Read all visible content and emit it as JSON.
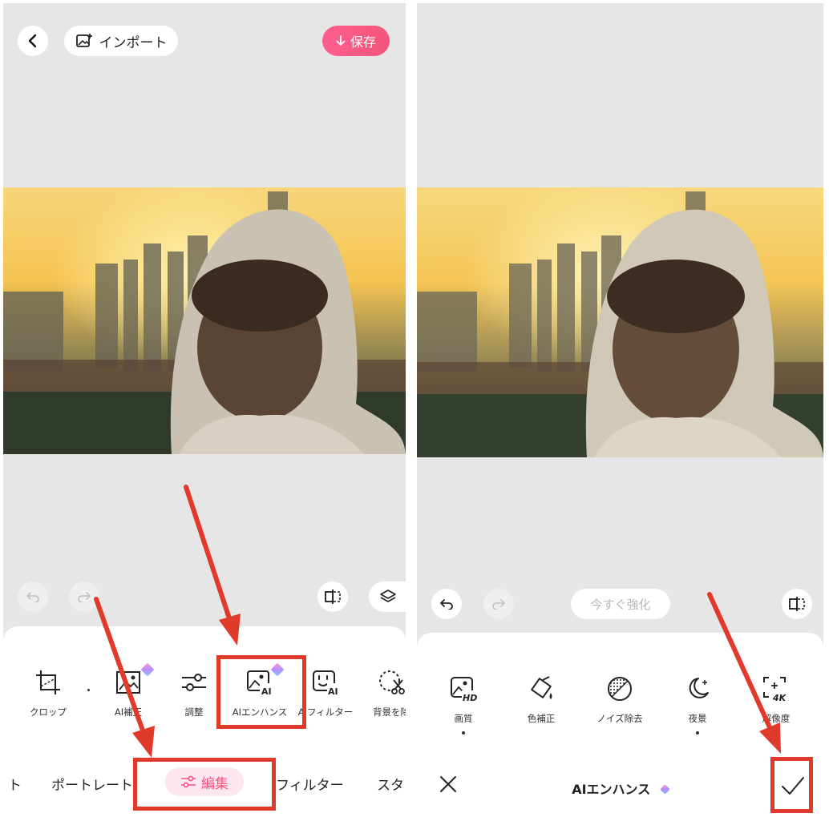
{
  "left": {
    "header": {
      "import_label": "インポート",
      "save_label": "保存"
    },
    "tools": [
      {
        "label": "クロップ",
        "icon": "crop-icon"
      },
      {
        "label": "AI補正",
        "icon": "ai-correct-icon"
      },
      {
        "label": "調整",
        "icon": "adjust-sliders-icon"
      },
      {
        "label": "AIエンハンス",
        "icon": "ai-enhance-icon"
      },
      {
        "label": "AIフィルター",
        "icon": "ai-filter-icon"
      },
      {
        "label": "背景を除",
        "icon": "remove-background-icon"
      }
    ],
    "tabs": [
      "ト",
      "ポートレート",
      "編集",
      "フィルター",
      "スタ"
    ],
    "active_tab": "編集"
  },
  "right": {
    "enhance_now_label": "今すぐ強化",
    "tools": [
      {
        "label": "画質",
        "icon": "hd-quality-icon",
        "dot": true
      },
      {
        "label": "色補正",
        "icon": "color-correct-icon",
        "dot": false
      },
      {
        "label": "ノイズ除去",
        "icon": "noise-removal-icon",
        "dot": false
      },
      {
        "label": "夜景",
        "icon": "night-scene-icon",
        "dot": true
      },
      {
        "label": "解像度",
        "icon": "resolution-4k-icon",
        "dot": false
      }
    ],
    "footer_title": "AIエンハンス"
  },
  "colors": {
    "accent": "#f0567d",
    "annotation_red": "#e03a2b"
  }
}
